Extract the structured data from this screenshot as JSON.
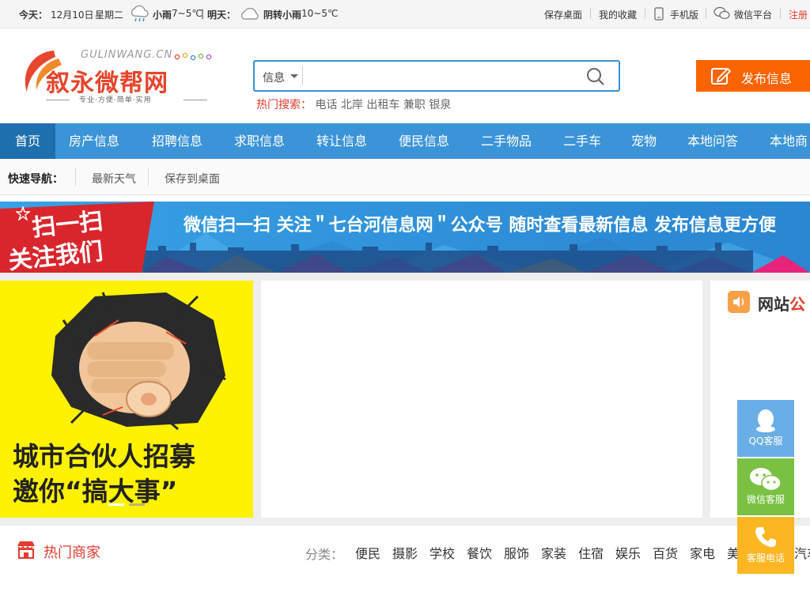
{
  "topbar": {
    "today_label": "今天：",
    "date": "12月10日",
    "weekday": "星期二",
    "today_weather": "小雨",
    "today_temp": "7~5℃",
    "divider": "|",
    "tomorrow_label": "明天：",
    "tomorrow_weather": "阴转小雨",
    "tomorrow_temp": "10~5℃",
    "links": {
      "save_desktop": "保存桌面",
      "favorites": "我的收藏",
      "mobile": "手机版",
      "wechat": "微信平台",
      "register": "注册"
    }
  },
  "logo": {
    "domain": "GULINWANG.CN",
    "name": "叙永微帮网",
    "slogan": "专业·方便·简单·实用"
  },
  "search": {
    "category": "信息",
    "value": "",
    "hot_label": "热门搜索：",
    "hot_terms": [
      "电话",
      "北岸",
      "出租车",
      "兼职",
      "银泉"
    ]
  },
  "publish": {
    "label": "发布信息"
  },
  "nav": {
    "items": [
      "首页",
      "房产信息",
      "招聘信息",
      "求职信息",
      "转让信息",
      "便民信息",
      "二手物品",
      "二手车",
      "宠物",
      "本地问答",
      "本地商"
    ]
  },
  "quicknav": {
    "label": "快速导航：",
    "links": [
      "最新天气",
      "保存到桌面"
    ]
  },
  "banner": {
    "badge_line1": "扫一扫",
    "badge_line2": "关注我们",
    "text": "微信扫一扫 关注＂七台河信息网＂公众号 随时查看最新信息 发布信息更方便"
  },
  "slider": {
    "line1": "城市合伙人招募",
    "line2": "邀你“搞大事”"
  },
  "notice": {
    "title_a": "网站",
    "title_b": "公"
  },
  "merchants": {
    "title": "热门商家",
    "category_label": "分类：",
    "categories": [
      "便民",
      "摄影",
      "学校",
      "餐饮",
      "服饰",
      "家装",
      "住宿",
      "娱乐",
      "百货",
      "家电",
      "美",
      "汽车"
    ]
  },
  "service": {
    "qq": "QQ客服",
    "wechat": "微信客服",
    "phone": "客服电话"
  },
  "colors": {
    "nav_blue": "#3c94d8",
    "nav_active": "#1e6fae",
    "publish_orange": "#fa6400",
    "hot_red": "#e33b2e",
    "qq_blue": "#69aee6",
    "wechat_green": "#7ac143",
    "phone_orange": "#fbb622",
    "slider_yellow": "#fff200"
  }
}
